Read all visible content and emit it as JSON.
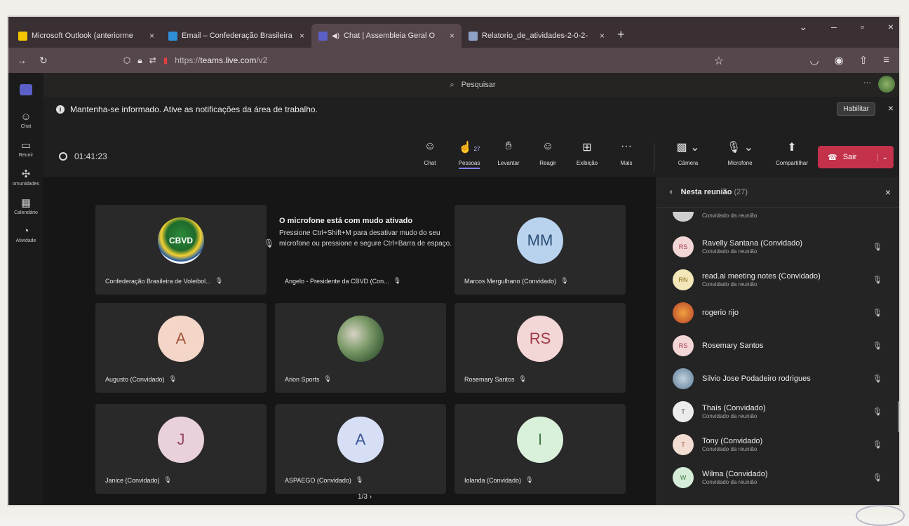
{
  "browser": {
    "tabs": [
      {
        "label": "Microsoft Outlook (anteriorme",
        "color": "#f5c400",
        "active": false
      },
      {
        "label": "Email – Confederação Brasileira",
        "color": "#2f8fd8",
        "active": false
      },
      {
        "label": "Chat | Assembleia Geral O",
        "color": "#5b5fc7",
        "active": true
      },
      {
        "label": "Relatorio_de_atividades-2-0-2-",
        "color": "#8da2c4",
        "active": false
      }
    ],
    "url_prefix": "https://",
    "url_host": "teams.live.com",
    "url_path": "/v2"
  },
  "rail": [
    {
      "label": "Chat",
      "icon": "chat-icon",
      "glyph": "☺"
    },
    {
      "label": "Reunir",
      "icon": "video-camera-icon",
      "glyph": "▭"
    },
    {
      "label": "omunidades",
      "icon": "communities-icon",
      "glyph": "✣"
    },
    {
      "label": "Calendário",
      "icon": "calendar-icon",
      "glyph": "▦"
    },
    {
      "label": "Atividade",
      "icon": "bell-icon",
      "glyph": "♫"
    }
  ],
  "search": {
    "placeholder": "Pesquisar"
  },
  "banner": {
    "text": "Mantenha-se informado. Ative as notificações da área de trabalho.",
    "enable_label": "Habilitar"
  },
  "meeting": {
    "timer": "01:41:23",
    "tools": {
      "chat": "Chat",
      "people": "Pessoas",
      "people_count": "27",
      "raise": "Levantar",
      "react": "Reagir",
      "view": "Exibição",
      "more": "Mais",
      "camera": "Câmera",
      "mic": "Microfone",
      "share": "Compartilhar",
      "leave": "Sair"
    },
    "mute_notice": {
      "title": "O microfone está com mudo ativado",
      "body": "Pressione Ctrl+Shift+M para desativar mudo do seu microfone ou pressione e segure Ctrl+Barra de espaço."
    },
    "tiles": [
      {
        "name": "Confederação Brasileira de Voleibol...",
        "initials": "CBVD",
        "color": "#2e8a3a"
      },
      {
        "name": "Angelo - Presidente da CBVD (Con...",
        "initials": "",
        "color": ""
      },
      {
        "name": "Marcos Mergulhano (Convidado)",
        "initials": "MM",
        "color": "#b9d3ee"
      },
      {
        "name": "Augusto (Convidado)",
        "initials": "A",
        "color": "#f3d6c7"
      },
      {
        "name": "Arion Sports",
        "initials": "",
        "color": ""
      },
      {
        "name": "Rosemary Santos",
        "initials": "RS",
        "color": "#f3d6d6"
      },
      {
        "name": "Janice (Convidado)",
        "initials": "J",
        "color": "#e9d1dc"
      },
      {
        "name": "ASPAEGO (Convidado)",
        "initials": "A",
        "color": "#d6dff5"
      },
      {
        "name": "Iolanda (Convidado)",
        "initials": "I",
        "color": "#d9f0da"
      }
    ],
    "pager": "1/3"
  },
  "panel": {
    "title": "Nesta reunião",
    "count": "(27)",
    "people": [
      {
        "name": "",
        "sub": "Convidado da reunião",
        "initials": "",
        "color": "#cfcfcf"
      },
      {
        "name": "Ravelly Santana (Convidado)",
        "sub": "Convidado da reunião",
        "initials": "RS",
        "color": "#f3d6d6"
      },
      {
        "name": "read.ai meeting notes (Convidado)",
        "sub": "Convidado da reunião",
        "initials": "RN",
        "color": "#f3e6b8"
      },
      {
        "name": "rogerio rijo",
        "sub": "",
        "initials": "",
        "color": "#d9812b"
      },
      {
        "name": "Rosemary Santos",
        "sub": "",
        "initials": "RS",
        "color": "#f3d6d6"
      },
      {
        "name": "Silvio Jose Podadeiro rodrigues",
        "sub": "",
        "initials": "",
        "color": "#8aa6bf"
      },
      {
        "name": "Thaís (Convidado)",
        "sub": "Convidado da reunião",
        "initials": "T",
        "color": "#ececec"
      },
      {
        "name": "Tony (Convidado)",
        "sub": "Convidado da reunião",
        "initials": "T",
        "color": "#f3ddd2"
      },
      {
        "name": "Wilma (Convidado)",
        "sub": "Convidado da reunião",
        "initials": "W",
        "color": "#d4ecd8"
      }
    ]
  }
}
